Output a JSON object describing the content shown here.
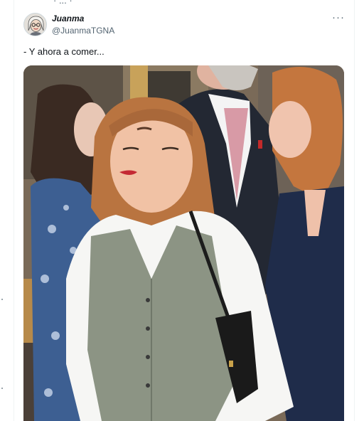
{
  "previous_tweet": {
    "fragment_text": "· ... ·"
  },
  "tweet": {
    "author": {
      "display_name": "Juanma",
      "handle": "@JuanmaTGNA",
      "avatar_icon": "avatar-cartoon-icon"
    },
    "more_options_label": "···",
    "text": "- Y ahora a comer...",
    "media": {
      "type": "photo"
    }
  },
  "colors": {
    "text_primary": "#0f1419",
    "text_secondary": "#536471",
    "border": "#eff3f4"
  }
}
